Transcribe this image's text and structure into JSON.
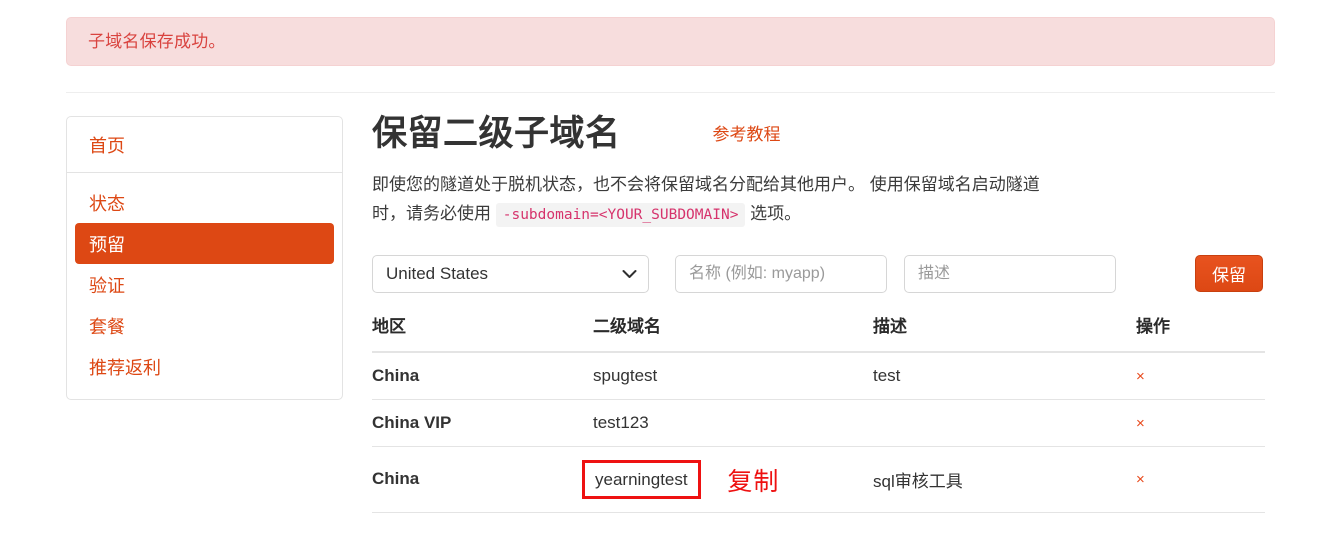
{
  "alert": {
    "message": "子域名保存成功。",
    "bg_color": "#f7dddd",
    "text_color": "#d9433f"
  },
  "sidebar": {
    "header_label": "首页",
    "items": [
      {
        "label": "状态",
        "active": false
      },
      {
        "label": "预留",
        "active": true
      },
      {
        "label": "验证",
        "active": false
      },
      {
        "label": "套餐",
        "active": false
      },
      {
        "label": "推荐返利",
        "active": false
      }
    ],
    "accent_color": "#dd4814"
  },
  "main": {
    "title": "保留二级子域名",
    "tutorial_link": "参考教程",
    "description_part1": "即使您的隧道处于脱机状态，也不会将保留域名分配给其他用户。 使用保留域名启动隧道时，请务必使用",
    "description_code": "-subdomain=<YOUR_SUBDOMAIN>",
    "description_part2": "选项。"
  },
  "form": {
    "country_selected": "United States",
    "country_options": [
      "United States"
    ],
    "name_placeholder": "名称 (例如: myapp)",
    "name_value": "",
    "desc_placeholder": "描述",
    "desc_value": "",
    "submit_label": "保留",
    "submit_color": "#dd4814"
  },
  "table": {
    "headers": [
      "地区",
      "二级域名",
      "描述",
      "操作"
    ],
    "rows": [
      {
        "region": "China",
        "domain": "spugtest",
        "desc": "test",
        "action": "×",
        "highlighted": false
      },
      {
        "region": "China VIP",
        "domain": "test123",
        "desc": "",
        "action": "×",
        "highlighted": false
      },
      {
        "region": "China",
        "domain": "yearningtest",
        "desc": "sql审核工具",
        "action": "×",
        "highlighted": true
      }
    ]
  },
  "annotations": {
    "copy_label": "复制",
    "box_color": "#ee1111"
  }
}
